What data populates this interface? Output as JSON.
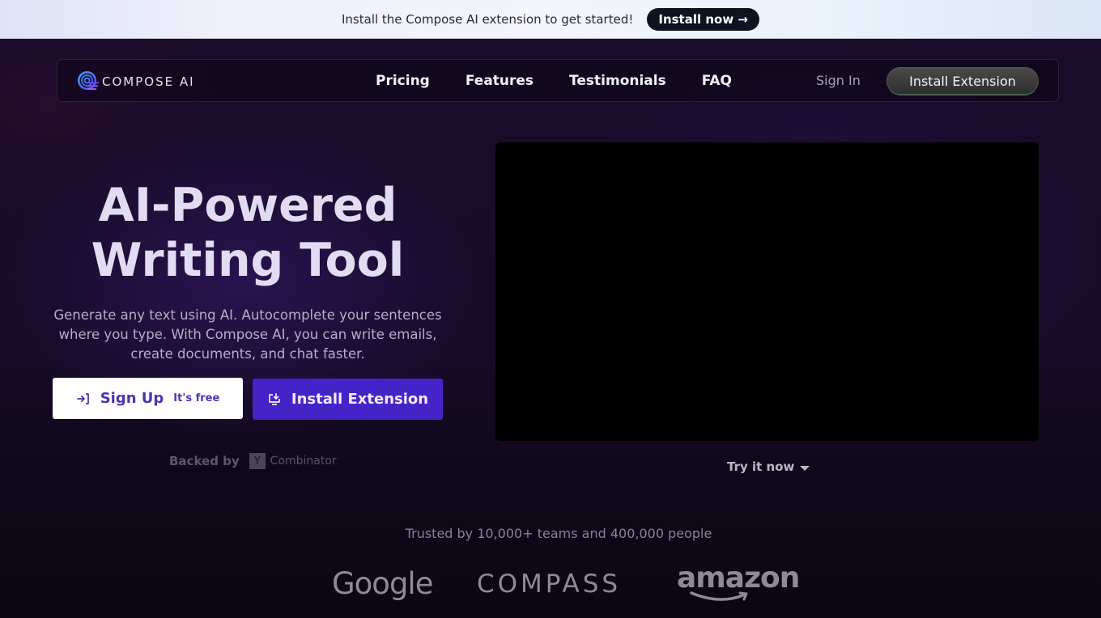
{
  "banner": {
    "text": "Install the Compose AI extension to get started!",
    "button_label": "Install now →"
  },
  "nav": {
    "brand": "COMPOSE AI",
    "links": [
      {
        "label": "Pricing"
      },
      {
        "label": "Features"
      },
      {
        "label": "Testimonials"
      },
      {
        "label": "FAQ"
      }
    ],
    "sign_in_label": "Sign In",
    "install_label": "Install Extension"
  },
  "hero": {
    "title_line1": "AI-Powered",
    "title_line2": "Writing Tool",
    "description": "Generate any text using AI. Autocomplete your sentences where you type. With Compose AI, you can write emails, create documents, and chat faster.",
    "signup_label": "Sign Up",
    "signup_badge": "It's free",
    "install_label": "Install Extension",
    "backed_by_label": "Backed by",
    "backer_mark": "Y",
    "backer_name": "Combinator"
  },
  "video": {
    "try_label": "Try it now"
  },
  "trust": {
    "text": "Trusted by 10,000+ teams and 400,000 people",
    "logos": [
      "Google",
      "COMPASS",
      "amazon"
    ]
  },
  "colors": {
    "primary_button": "#4524c7",
    "signup_text": "#4a35b5",
    "background": "#160b28",
    "banner_button": "#0d1420"
  }
}
